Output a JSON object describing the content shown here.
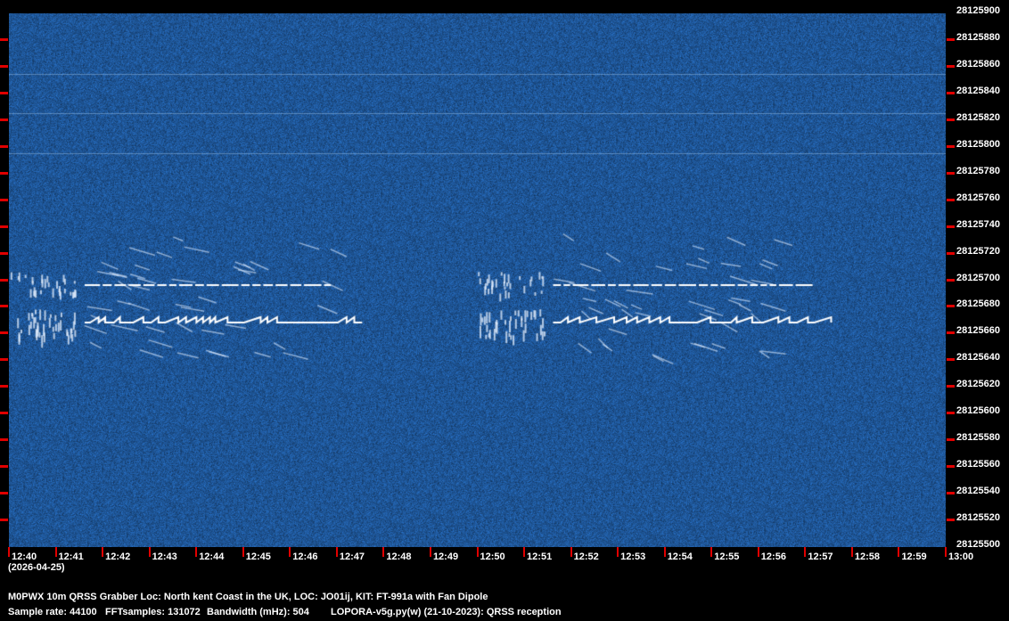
{
  "chart_data": {
    "type": "heatmap",
    "title": "M0PWX 10m QRSS Grabber Loc: North kent Coast in the UK, LOC: JO01ij, KIT: FT-991a with Fan Dipole",
    "xlabel": "(2026-04-25)",
    "ylabel": "",
    "x_ticks": [
      "12:40",
      "12:41",
      "12:42",
      "12:43",
      "12:44",
      "12:45",
      "12:46",
      "12:47",
      "12:48",
      "12:49",
      "12:50",
      "12:51",
      "12:52",
      "12:53",
      "12:54",
      "12:55",
      "12:56",
      "12:57",
      "12:58",
      "12:59",
      "13:00"
    ],
    "y_ticks": [
      28125900,
      28125880,
      28125860,
      28125840,
      28125820,
      28125800,
      28125780,
      28125760,
      28125740,
      28125720,
      28125700,
      28125680,
      28125660,
      28125640,
      28125620,
      28125600,
      28125580,
      28125560,
      28125540,
      28125520,
      28125500
    ],
    "ylim": [
      28125500,
      28125900
    ],
    "xlim": [
      "12:40",
      "13:00"
    ],
    "signals": [
      {
        "start": "12:40",
        "end": "12:47",
        "freq_upper": 28125696,
        "freq_lower": 28125668
      },
      {
        "start": "12:50",
        "end": "12:57",
        "freq_upper": 28125696,
        "freq_lower": 28125668
      }
    ],
    "colors": {
      "background": "#2b5a96",
      "signal": "#ffffff",
      "tick": "#e00000"
    }
  },
  "footer": {
    "date": "(2026-04-25)",
    "title": "M0PWX 10m QRSS Grabber Loc: North kent Coast in the UK, LOC: JO01ij, KIT: FT-991a with Fan Dipole",
    "sample_rate": "Sample rate: 44100",
    "fft_samples": "FFTsamples: 131072",
    "bandwidth": "Bandwidth (mHz): 504",
    "software": "LOPORA-v5g.py(w) (21-10-2023): QRSS reception"
  }
}
